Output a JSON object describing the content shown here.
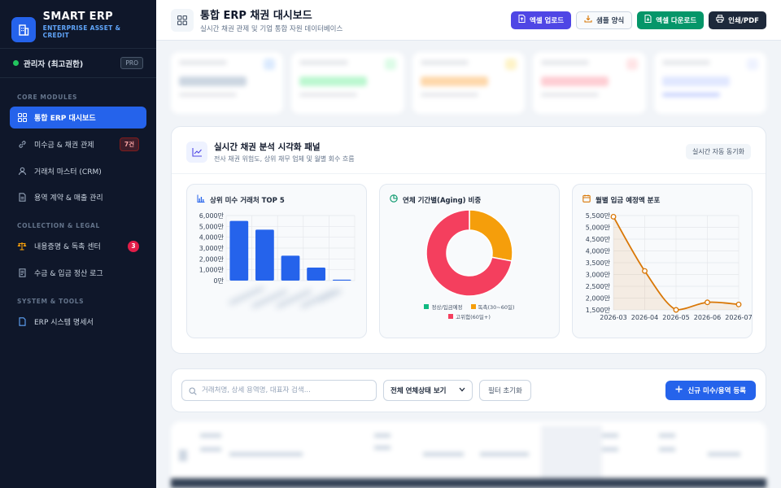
{
  "sidebar": {
    "brand_name": "SMART ERP",
    "brand_sub": "ENTERPRISE ASSET & CREDIT",
    "user_name": "관리자 (최고권한)",
    "user_badge": "PRO",
    "sections": [
      "CORE MODULES",
      "COLLECTION & LEGAL",
      "SYSTEM & TOOLS"
    ],
    "items": [
      {
        "label": "통합 ERP 대시보드",
        "icon": "grid-icon",
        "active": true
      },
      {
        "label": "미수금 & 채권 관제",
        "icon": "link-icon",
        "badge": "7건"
      },
      {
        "label": "거래처 마스터 (CRM)",
        "icon": "user-icon"
      },
      {
        "label": "용역 계약 & 매출 관리",
        "icon": "document-icon"
      },
      {
        "label": "내용증명 & 독촉 센터",
        "icon": "scale-icon",
        "badge": "3"
      },
      {
        "label": "수금 & 입금 정산 로그",
        "icon": "receipt-icon"
      },
      {
        "label": "ERP 시스템 명세서",
        "icon": "file-icon"
      }
    ]
  },
  "header": {
    "title": "통합 ERP 채권 대시보드",
    "subtitle": "실시간 채권 관제 및 기업 통합 자원 데이터베이스",
    "buttons": {
      "upload": "엑셀 업로드",
      "sample": "샘플 양식",
      "download": "엑셀 다운로드",
      "print": "인쇄/PDF"
    }
  },
  "viz": {
    "title": "실시간 채권 분석 시각화 패널",
    "subtitle": "전사 채권 위험도, 상위 채무 업체 및 월별 회수 흐름",
    "sync_label": "실시간 자동 동기화"
  },
  "chart_data": [
    {
      "type": "bar",
      "title": "상위 미수 거래처 TOP 5",
      "y_ticks": [
        "6,000만",
        "5,000만",
        "4,000만",
        "3,000만",
        "2,000만",
        "1,000만",
        "0만"
      ],
      "ylim": [
        0,
        6000
      ],
      "values": [
        5500,
        4700,
        2300,
        1200,
        80
      ],
      "color": "#2563eb"
    },
    {
      "type": "pie",
      "title": "연체 기간별(Aging) 비중",
      "slices": [
        {
          "name": "정상/입금예정",
          "value": 0,
          "color": "#10b981"
        },
        {
          "name": "독촉(30~60일)",
          "value": 28,
          "color": "#f59e0b"
        },
        {
          "name": "고위험(60일+)",
          "value": 72,
          "color": "#f43f5e"
        }
      ]
    },
    {
      "type": "line",
      "title": "월별 입금 예정액 분포",
      "x": [
        "2026-03",
        "2026-04",
        "2026-05",
        "2026-06",
        "2026-07"
      ],
      "values": [
        5450,
        3150,
        1500,
        1820,
        1730
      ],
      "y_ticks": [
        "5,500만",
        "5,000만",
        "4,500만",
        "4,000만",
        "3,500만",
        "3,000만",
        "2,500만",
        "2,000만",
        "1,500만"
      ],
      "ylim": [
        1500,
        5500
      ],
      "color": "#d97706"
    }
  ],
  "filter": {
    "search_placeholder": "거래처명, 상세 용역명, 대표자 검색...",
    "status_select": "전체 연체상태 보기",
    "reset_label": "필터 초기화",
    "add_label": "신규 미수/용역 등록"
  }
}
